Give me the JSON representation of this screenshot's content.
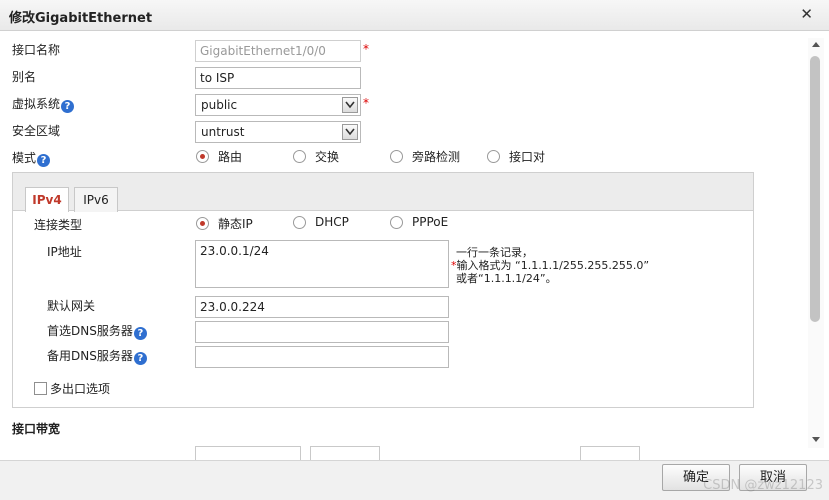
{
  "dialog": {
    "title": "修改GigabitEthernet",
    "close_glyph": "✕"
  },
  "form": {
    "interface_name": {
      "label": "接口名称",
      "value": "GigabitEthernet1/0/0"
    },
    "alias": {
      "label": "别名",
      "value": "to ISP"
    },
    "virtual_system": {
      "label": "虚拟系统",
      "value": "public"
    },
    "security_zone": {
      "label": "安全区域",
      "value": "untrust"
    },
    "mode": {
      "label": "模式",
      "options": [
        "路由",
        "交换",
        "旁路检测",
        "接口对"
      ],
      "selected": "路由"
    },
    "required_mark": "*",
    "help_glyph": "?"
  },
  "tabs": [
    {
      "label": "IPv4",
      "active": true
    },
    {
      "label": "IPv6",
      "active": false
    }
  ],
  "ipv4": {
    "connection_type": {
      "label": "连接类型",
      "options": [
        "静态IP",
        "DHCP",
        "PPPoE"
      ],
      "selected": "静态IP"
    },
    "ip_address": {
      "label": "IP地址",
      "value": "23.0.0.1/24"
    },
    "hint": {
      "line1": "一行一条记录，",
      "line2_star": "*",
      "line2": "输入格式为 “1.1.1.1/255.255.255.0”",
      "line3": "或者“1.1.1.1/24”。"
    },
    "default_gateway": {
      "label": "默认网关",
      "value": "23.0.0.224"
    },
    "primary_dns": {
      "label": "首选DNS服务器",
      "value": ""
    },
    "secondary_dns": {
      "label": "备用DNS服务器",
      "value": ""
    },
    "multi_exit": {
      "label": "多出口选项",
      "checked": false
    }
  },
  "bandwidth_section": {
    "title": "接口带宽"
  },
  "footer": {
    "ok_label": "确定",
    "cancel_label": "取消"
  },
  "watermark": "CSDN @zwz12123"
}
